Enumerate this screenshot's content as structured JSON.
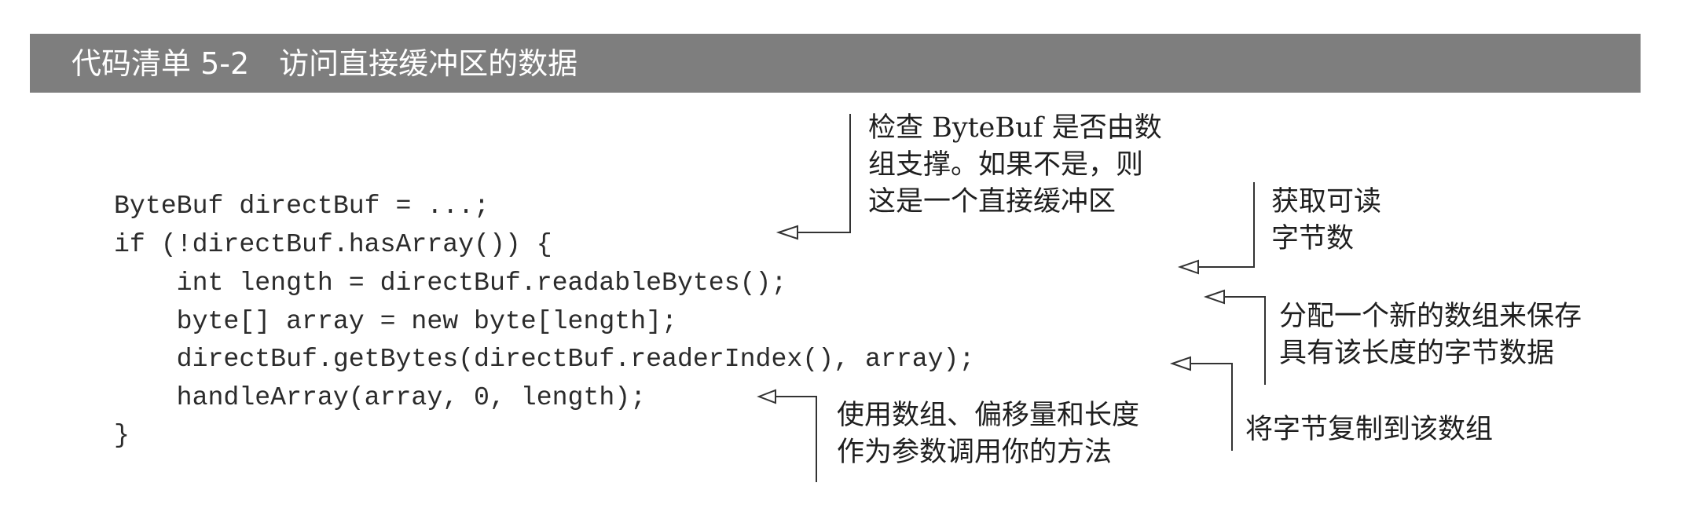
{
  "listing": {
    "title": "代码清单 5-2　访问直接缓冲区的数据"
  },
  "code_lines": [
    "ByteBuf directBuf = ...;",
    "if (!directBuf.hasArray()) {",
    "    int length = directBuf.readableBytes();",
    "    byte[] array = new byte[length];",
    "    directBuf.getBytes(directBuf.readerIndex(), array);",
    "    handleArray(array, 0, length);",
    "}"
  ],
  "annotations": [
    {
      "lines": [
        "检查 ByteBuf 是否由数",
        "组支撑。如果不是，则",
        "这是一个直接缓冲区"
      ]
    },
    {
      "lines": [
        "获取可读",
        "字节数"
      ]
    },
    {
      "lines": [
        "分配一个新的数组来保存",
        "具有该长度的字节数据"
      ]
    },
    {
      "lines": [
        "将字节复制到该数组"
      ]
    },
    {
      "lines": [
        "使用数组、偏移量和长度",
        "作为参数调用你的方法"
      ]
    }
  ],
  "colors": {
    "title_bar": "#7e7e7e",
    "title_text": "#ffffff",
    "code_text": "#2b2b2b",
    "leader_line": "#333333"
  }
}
